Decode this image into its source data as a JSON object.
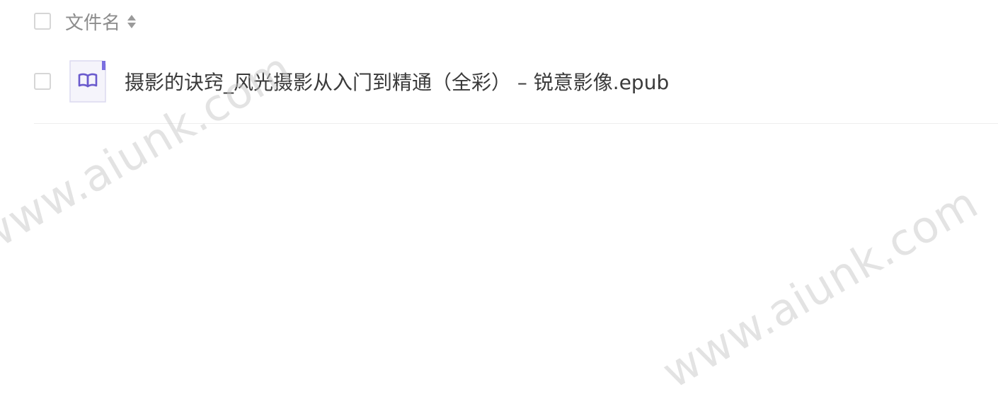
{
  "file_list": {
    "header": {
      "column_title": "文件名"
    },
    "files": [
      {
        "name": "摄影的诀窍_风光摄影从入门到精通（全彩） – 锐意影像.epub",
        "icon": "book-icon",
        "icon_color": "#6a5acd"
      }
    ]
  },
  "watermark": {
    "text": "www.aiunk.com"
  }
}
